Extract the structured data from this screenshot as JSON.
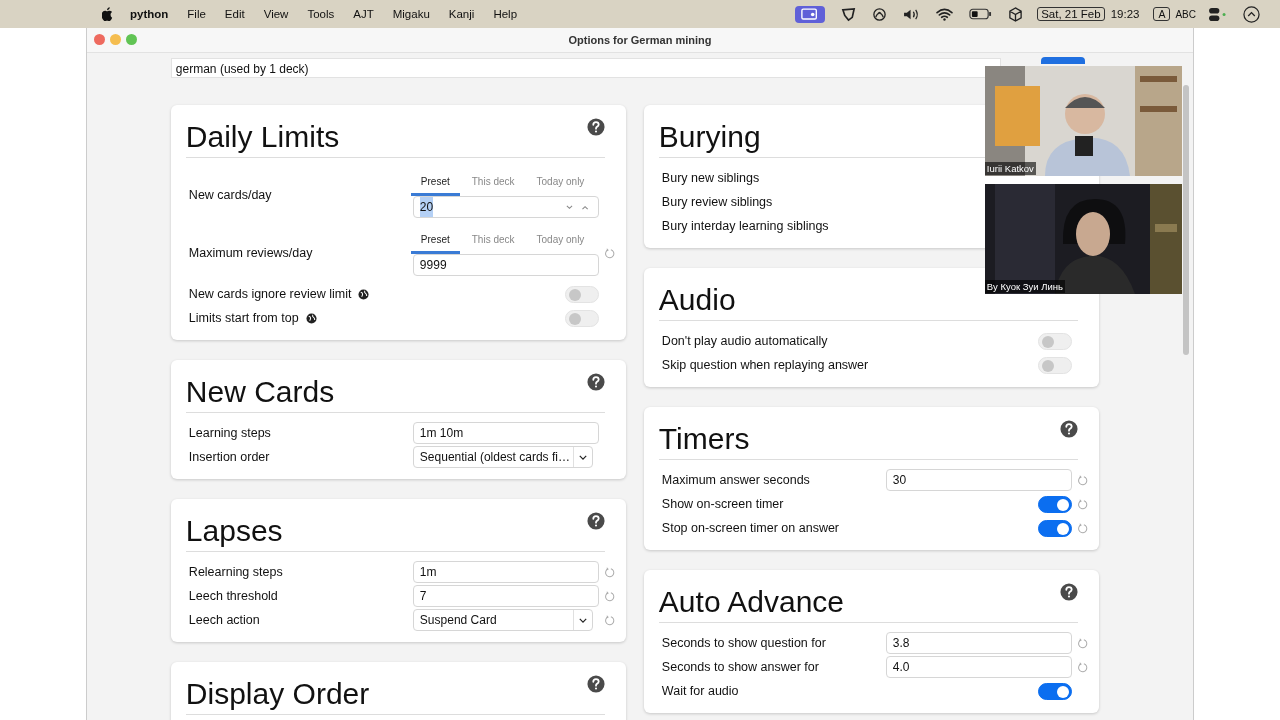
{
  "menubar": {
    "app": "python",
    "menus": [
      "File",
      "Edit",
      "View",
      "Tools",
      "AJT",
      "Migaku",
      "Kanji",
      "Help"
    ],
    "date": "Sat, 21 Feb",
    "time": "19:23",
    "input_badge": "A",
    "input_name": "ABC"
  },
  "window": {
    "title": "Options for German mining"
  },
  "preset": {
    "value": "german (used by 1 deck)"
  },
  "columns": [
    [
      {
        "title": "Daily Limits",
        "help": true,
        "rows": [
          {
            "kind": "spin",
            "label": "New cards/day",
            "tabs": [
              {
                "label": "Preset",
                "selected": true
              },
              {
                "label": "This deck",
                "selected": false
              },
              {
                "label": "Today only",
                "selected": false
              }
            ],
            "value": "20",
            "highlighted": true,
            "reset": false
          },
          {
            "kind": "number",
            "label": "Maximum reviews/day",
            "tabs": [
              {
                "label": "Preset",
                "selected": true
              },
              {
                "label": "This deck",
                "selected": false
              },
              {
                "label": "Today only",
                "selected": false
              }
            ],
            "value": "9999",
            "reset": true
          },
          {
            "kind": "toggle",
            "label": "New cards ignore review limit",
            "globe": true,
            "on": false,
            "reset": false
          },
          {
            "kind": "toggle",
            "label": "Limits start from top",
            "globe": true,
            "on": false,
            "reset": false
          }
        ]
      },
      {
        "title": "New Cards",
        "help": true,
        "rows": [
          {
            "kind": "number",
            "label": "Learning steps",
            "value": "1m 10m",
            "reset": false
          },
          {
            "kind": "select",
            "label": "Insertion order",
            "value": "Sequential (oldest cards fi…",
            "reset": false
          }
        ]
      },
      {
        "title": "Lapses",
        "help": true,
        "rows": [
          {
            "kind": "number",
            "label": "Relearning steps",
            "value": "1m",
            "reset": true
          },
          {
            "kind": "number",
            "label": "Leech threshold",
            "value": "7",
            "reset": true
          },
          {
            "kind": "select",
            "label": "Leech action",
            "value": "Suspend Card",
            "reset": true
          }
        ]
      },
      {
        "title": "Display Order",
        "help": true
      }
    ],
    [
      {
        "title": "Burying",
        "rows": [
          {
            "kind": "label",
            "label": "Bury new siblings"
          },
          {
            "kind": "label",
            "label": "Bury review siblings"
          },
          {
            "kind": "label",
            "label": "Bury interday learning siblings"
          }
        ]
      },
      {
        "title": "Audio",
        "rows": [
          {
            "kind": "toggle",
            "label": "Don't play audio automatically",
            "on": false,
            "reset": false
          },
          {
            "kind": "toggle",
            "label": "Skip question when replaying answer",
            "on": false,
            "reset": false
          }
        ]
      },
      {
        "title": "Timers",
        "help": true,
        "rows": [
          {
            "kind": "number",
            "label": "Maximum answer seconds",
            "value": "30",
            "reset": true
          },
          {
            "kind": "toggle",
            "label": "Show on-screen timer",
            "on": true,
            "reset": true
          },
          {
            "kind": "toggle",
            "label": "Stop on-screen timer on answer",
            "on": true,
            "reset": true
          }
        ]
      },
      {
        "title": "Auto Advance",
        "help": true,
        "rows": [
          {
            "kind": "number",
            "label": "Seconds to show question for",
            "value": "3.8",
            "reset": true
          },
          {
            "kind": "number",
            "label": "Seconds to show answer for",
            "value": "4.0",
            "reset": true
          },
          {
            "kind": "toggle",
            "label": "Wait for audio",
            "on": true,
            "reset": false
          }
        ]
      }
    ]
  ],
  "video_tiles": [
    {
      "name": "Iurii Katkov",
      "kind": "light"
    },
    {
      "name": "Ву Куок Зуи Линь",
      "kind": "dark"
    }
  ]
}
